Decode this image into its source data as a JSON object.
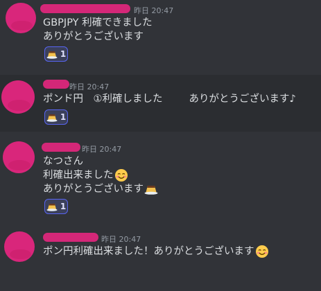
{
  "messages": [
    {
      "timestamp": "昨日 20:47",
      "lines": [
        "GBPJPY 利確できました",
        "ありがとうございます"
      ],
      "reaction": {
        "emoji": "pudding-icon",
        "count": "1"
      }
    },
    {
      "timestamp": "昨日 20:47",
      "line_part1": "ポンド円　①利確しました",
      "line_part2": "ありがとうございます♪",
      "reaction": {
        "emoji": "pudding-icon",
        "count": "1"
      }
    },
    {
      "timestamp": "昨日 20:47",
      "lines": [
        "なつさん",
        "利確出来ました",
        "ありがとうございます"
      ],
      "reaction": {
        "emoji": "pudding-icon",
        "count": "1"
      }
    },
    {
      "timestamp": "昨日 20:47",
      "lines": [
        "ポン円利確出来ました！ありがとうございます"
      ]
    }
  ],
  "colors": {
    "background": "#313338",
    "highlight": "#2b2d31",
    "redaction": "#d9267b",
    "reaction_border": "#5865f2",
    "reaction_bg": "#3b405a",
    "text": "#dbdee1",
    "timestamp": "#949ba4"
  }
}
